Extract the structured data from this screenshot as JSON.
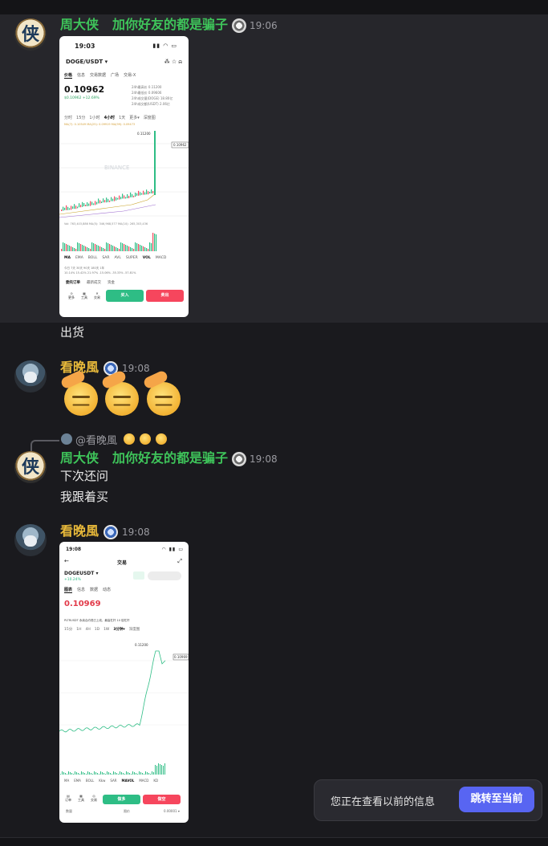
{
  "messages": {
    "m1": {
      "username": "周大侠",
      "suffix": "加你好友的都是骗子",
      "time": "19:06",
      "text": "出货"
    },
    "m2": {
      "username": "看晚風",
      "time": "19:08"
    },
    "m3": {
      "reply_to": "@看晚風",
      "username": "周大侠",
      "suffix": "加你好友的都是骗子",
      "time": "19:08",
      "line1": "下次还问",
      "line2": "我跟着买"
    },
    "m4": {
      "username": "看晚風",
      "time": "19:08"
    }
  },
  "shot1": {
    "time": "19:03",
    "pair": "DOGE/USDT ▾",
    "tabs": [
      "价格",
      "信息",
      "交易数据",
      "广场",
      "交易-X"
    ],
    "price": "0.10962",
    "sub": "$0.10962 +12.69%",
    "stats": [
      "24h最高价 0.11200",
      "24h最低价 0.09606",
      "24h成交量(DOGE) 18.80亿",
      "24h成交额(USDT) 2.06亿"
    ],
    "intervals": [
      "分时",
      "15分",
      "1小时",
      "4小时",
      "1天",
      "更多▾",
      "深度图"
    ],
    "ma": "MA(7): 0.10549  MA(25): 0.09919  MA(99): 0.09473",
    "watermark": "BINANCE",
    "price_tag": "0.10962",
    "high_tag": "0.11200",
    "vol": "Vol: 763,403,886  MA(5): 346,968,577  MA(10): 265,303,436",
    "indicators": [
      "MA",
      "EMA",
      "BOLL",
      "SAR",
      "AVL",
      "SUPER",
      "VOL",
      "MACD"
    ],
    "perf_labels": "今日   7天    30天   90天   180天   1年",
    "perf_values": "10.14%  15.42%  21.97%  -15.06%  -35.33%  -57.81%",
    "bottom_tabs": [
      "委托订单",
      "最新成交",
      "资金"
    ],
    "tools": [
      "更多",
      "工具",
      "交易"
    ],
    "buy": "买入",
    "sell": "卖出"
  },
  "shot2": {
    "time": "19:08",
    "header": "交易",
    "pair": "DOGEUSDT ▾",
    "change": "+10.24%",
    "tabs": [
      "图表",
      "信息",
      "数据",
      "动态"
    ],
    "price": "0.10969",
    "notice": "PLTRUSDT 永续合约现已上线，最高杠杆 10 倍杠杆",
    "intervals": [
      "15分",
      "1H",
      "4H",
      "1D",
      "1W",
      "1M",
      "3分钟▾",
      "深度图"
    ],
    "high_tag": "0.11200",
    "price_tag": "0.10969",
    "indicators": [
      "MA",
      "EMA",
      "BOLL",
      "Kkw",
      "SAR",
      "MAVOL",
      "MACD",
      "KD"
    ],
    "buy": "做多",
    "sell": "做空",
    "tools": [
      "订单",
      "工具",
      "交易"
    ],
    "footer_left": "数量",
    "footer_mid": "限价",
    "footer_right": "0.00001 ▾"
  },
  "toast": {
    "text": "您正在查看以前的信息",
    "button": "跳转至当前"
  }
}
